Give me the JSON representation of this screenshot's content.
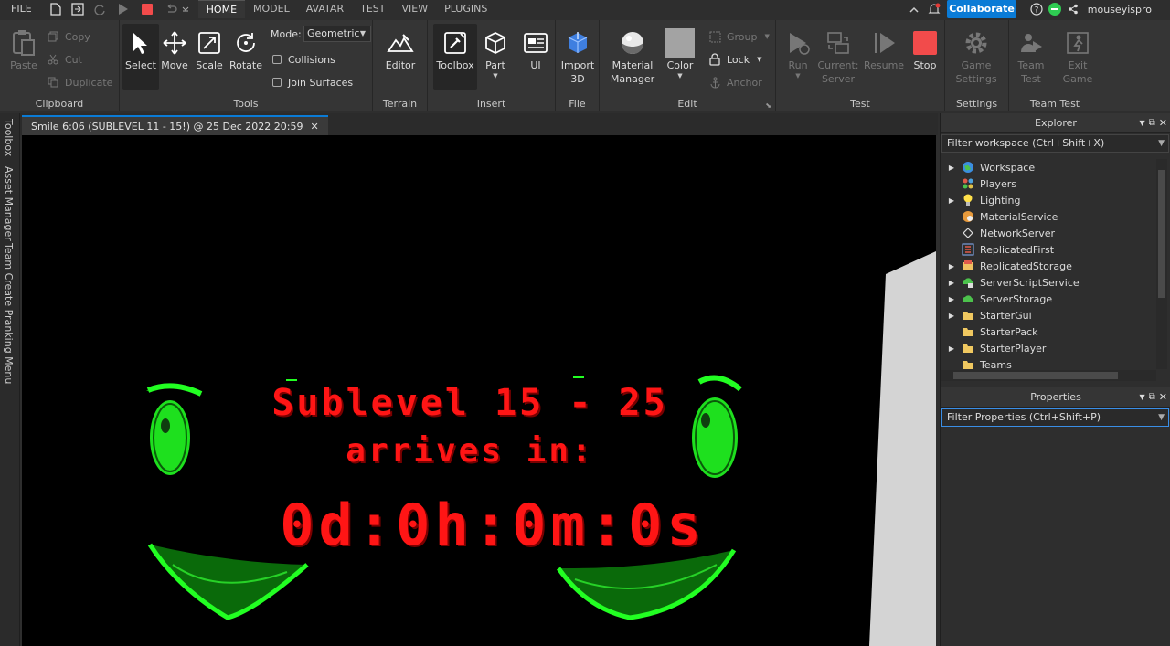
{
  "menu": {
    "file": "FILE",
    "tabs": [
      "HOME",
      "MODEL",
      "AVATAR",
      "TEST",
      "VIEW",
      "PLUGINS"
    ],
    "collaborate": "Collaborate",
    "username": "mouseyispro"
  },
  "ribbon": {
    "clipboard": {
      "paste": "Paste",
      "copy": "Copy",
      "cut": "Cut",
      "duplicate": "Duplicate",
      "label": "Clipboard"
    },
    "tools": {
      "select": "Select",
      "move": "Move",
      "scale": "Scale",
      "rotate": "Rotate",
      "mode_label": "Mode:",
      "mode_value": "Geometric",
      "collisions": "Collisions",
      "join_surfaces": "Join Surfaces",
      "label": "Tools"
    },
    "terrain": {
      "editor": "Editor",
      "label": "Terrain"
    },
    "insert": {
      "toolbox": "Toolbox",
      "part": "Part",
      "ui": "UI",
      "label": "Insert"
    },
    "file": {
      "import3d_1": "Import",
      "import3d_2": "3D",
      "label": "File"
    },
    "edit": {
      "material_1": "Material",
      "material_2": "Manager",
      "color": "Color",
      "group": "Group",
      "lock": "Lock",
      "anchor": "Anchor",
      "label": "Edit"
    },
    "test": {
      "run": "Run",
      "current_1": "Current:",
      "current_2": "Server",
      "resume": "Resume",
      "stop": "Stop",
      "label": "Test"
    },
    "settings": {
      "game_1": "Game",
      "game_2": "Settings",
      "label": "Settings"
    },
    "teamtest": {
      "team_1": "Team",
      "team_2": "Test",
      "exit_1": "Exit",
      "exit_2": "Game",
      "label": "Team Test"
    }
  },
  "left_tabs": [
    "Toolbox",
    "Asset Manager",
    "Team Create Pranking Menu"
  ],
  "document_tab": "Smile 6:06 (SUBLEVEL 11 - 15!) @ 25 Dec 2022 20:59",
  "viewport": {
    "title": "Sublevel 15 - 25",
    "subtitle": "arrives in:",
    "countdown": "0d:0h:0m:0s"
  },
  "explorer": {
    "title": "Explorer",
    "filter_placeholder": "Filter workspace (Ctrl+Shift+X)",
    "items": [
      {
        "name": "Workspace",
        "expandable": true,
        "icon": "globe-icon"
      },
      {
        "name": "Players",
        "expandable": false,
        "icon": "players-icon"
      },
      {
        "name": "Lighting",
        "expandable": true,
        "icon": "lightbulb-icon"
      },
      {
        "name": "MaterialService",
        "expandable": false,
        "icon": "material-icon"
      },
      {
        "name": "NetworkServer",
        "expandable": false,
        "icon": "diamond-icon"
      },
      {
        "name": "ReplicatedFirst",
        "expandable": false,
        "icon": "replicated-first-icon"
      },
      {
        "name": "ReplicatedStorage",
        "expandable": true,
        "icon": "replicated-storage-icon"
      },
      {
        "name": "ServerScriptService",
        "expandable": true,
        "icon": "server-script-icon"
      },
      {
        "name": "ServerStorage",
        "expandable": true,
        "icon": "server-storage-icon"
      },
      {
        "name": "StarterGui",
        "expandable": true,
        "icon": "folder-icon"
      },
      {
        "name": "StarterPack",
        "expandable": false,
        "icon": "folder-icon"
      },
      {
        "name": "StarterPlayer",
        "expandable": true,
        "icon": "folder-icon"
      },
      {
        "name": "Teams",
        "expandable": false,
        "icon": "folder-icon"
      }
    ]
  },
  "properties": {
    "title": "Properties",
    "filter_placeholder": "Filter Properties (Ctrl+Shift+P)"
  },
  "colors": {
    "accent": "#0a7bd6",
    "stop": "#f24b4b",
    "smile_green": "#22ff22",
    "text_red": "#ff1515"
  }
}
